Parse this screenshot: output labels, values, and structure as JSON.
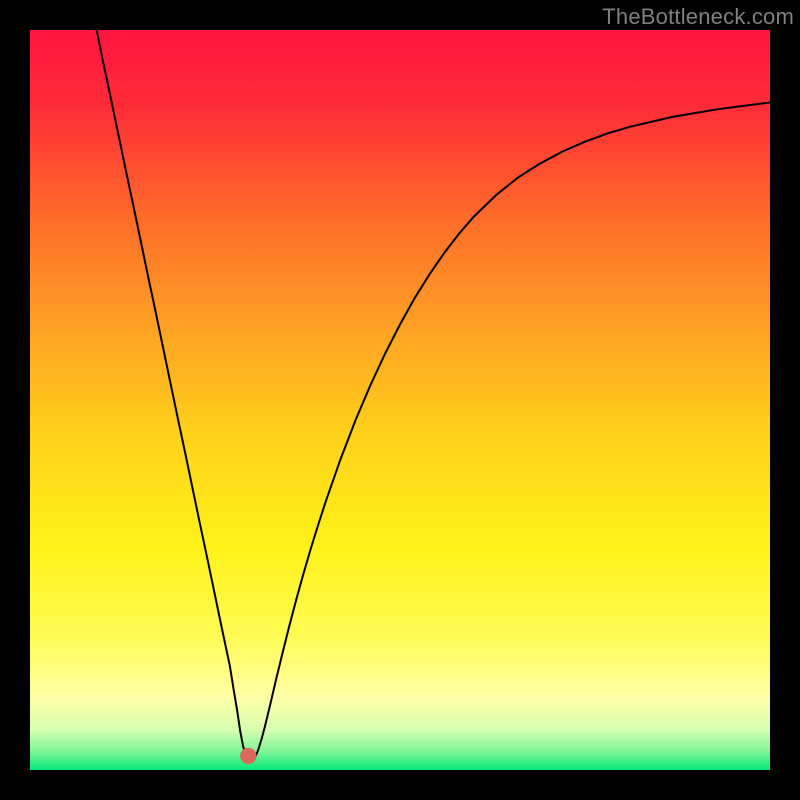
{
  "watermark": "TheBottleneck.com",
  "chart_data": {
    "type": "line",
    "title": "",
    "xlabel": "",
    "ylabel": "",
    "xlim": [
      0,
      100
    ],
    "ylim": [
      0,
      100
    ],
    "grid": false,
    "legend": false,
    "gradient_stops": [
      {
        "offset": 0.0,
        "color": "#ff1440"
      },
      {
        "offset": 0.1,
        "color": "#ff2b38"
      },
      {
        "offset": 0.25,
        "color": "#ff6a2a"
      },
      {
        "offset": 0.4,
        "color": "#ffa024"
      },
      {
        "offset": 0.55,
        "color": "#ffd21a"
      },
      {
        "offset": 0.7,
        "color": "#fff21a"
      },
      {
        "offset": 0.82,
        "color": "#fffb55"
      },
      {
        "offset": 0.9,
        "color": "#ffffa5"
      },
      {
        "offset": 0.945,
        "color": "#d8ffb0"
      },
      {
        "offset": 0.975,
        "color": "#7ff598"
      },
      {
        "offset": 1.0,
        "color": "#00e878"
      }
    ],
    "marker": {
      "x": 29.5,
      "y": 1.9,
      "r": 1.1,
      "color": "#d86a5a"
    },
    "series": [
      {
        "name": "curve",
        "color": "#000000",
        "width": 2,
        "points": [
          {
            "x": 9.0,
            "y": 100.0
          },
          {
            "x": 10.0,
            "y": 95.1
          },
          {
            "x": 11.0,
            "y": 90.4
          },
          {
            "x": 12.0,
            "y": 85.6
          },
          {
            "x": 13.0,
            "y": 80.8
          },
          {
            "x": 14.0,
            "y": 76.1
          },
          {
            "x": 15.0,
            "y": 71.3
          },
          {
            "x": 16.0,
            "y": 66.5
          },
          {
            "x": 17.0,
            "y": 61.8
          },
          {
            "x": 18.0,
            "y": 57.0
          },
          {
            "x": 19.0,
            "y": 52.2
          },
          {
            "x": 20.0,
            "y": 47.4
          },
          {
            "x": 21.0,
            "y": 42.7
          },
          {
            "x": 22.0,
            "y": 37.9
          },
          {
            "x": 23.0,
            "y": 33.1
          },
          {
            "x": 24.0,
            "y": 28.4
          },
          {
            "x": 25.0,
            "y": 23.6
          },
          {
            "x": 26.0,
            "y": 18.8
          },
          {
            "x": 27.0,
            "y": 14.1
          },
          {
            "x": 27.5,
            "y": 11.0
          },
          {
            "x": 28.0,
            "y": 8.0
          },
          {
            "x": 28.4,
            "y": 5.3
          },
          {
            "x": 28.8,
            "y": 3.2
          },
          {
            "x": 29.2,
            "y": 1.9
          },
          {
            "x": 29.6,
            "y": 1.3
          },
          {
            "x": 30.0,
            "y": 1.3
          },
          {
            "x": 30.4,
            "y": 1.7
          },
          {
            "x": 30.8,
            "y": 2.6
          },
          {
            "x": 31.3,
            "y": 4.2
          },
          {
            "x": 31.8,
            "y": 6.1
          },
          {
            "x": 32.5,
            "y": 9.0
          },
          {
            "x": 33.2,
            "y": 12.0
          },
          {
            "x": 34.0,
            "y": 15.3
          },
          {
            "x": 35.0,
            "y": 19.3
          },
          {
            "x": 36.0,
            "y": 23.1
          },
          {
            "x": 37.0,
            "y": 26.7
          },
          {
            "x": 38.0,
            "y": 30.1
          },
          {
            "x": 39.0,
            "y": 33.3
          },
          {
            "x": 40.0,
            "y": 36.4
          },
          {
            "x": 42.0,
            "y": 42.1
          },
          {
            "x": 44.0,
            "y": 47.3
          },
          {
            "x": 46.0,
            "y": 52.0
          },
          {
            "x": 48.0,
            "y": 56.3
          },
          {
            "x": 50.0,
            "y": 60.2
          },
          {
            "x": 52.0,
            "y": 63.8
          },
          {
            "x": 54.0,
            "y": 67.0
          },
          {
            "x": 56.0,
            "y": 69.9
          },
          {
            "x": 58.0,
            "y": 72.5
          },
          {
            "x": 60.0,
            "y": 74.8
          },
          {
            "x": 63.0,
            "y": 77.7
          },
          {
            "x": 66.0,
            "y": 80.1
          },
          {
            "x": 69.0,
            "y": 82.0
          },
          {
            "x": 72.0,
            "y": 83.6
          },
          {
            "x": 75.0,
            "y": 84.9
          },
          {
            "x": 78.0,
            "y": 86.0
          },
          {
            "x": 81.0,
            "y": 86.9
          },
          {
            "x": 84.0,
            "y": 87.6
          },
          {
            "x": 87.0,
            "y": 88.3
          },
          {
            "x": 90.0,
            "y": 88.8
          },
          {
            "x": 93.0,
            "y": 89.3
          },
          {
            "x": 96.0,
            "y": 89.7
          },
          {
            "x": 100.0,
            "y": 90.2
          }
        ]
      }
    ]
  }
}
